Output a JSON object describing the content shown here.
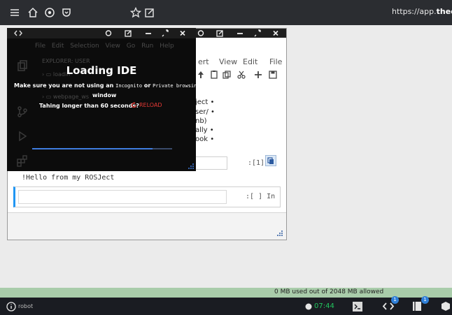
{
  "browser": {
    "url_prefix": "https://app.",
    "url_bold": "theconstr"
  },
  "ide": {
    "menu": "File Edit Selection View Go Run Help",
    "explorer_label": "EXPLORER: USER",
    "tree_item_1": "loadin",
    "tree_item_2": "webpage_ws",
    "title": "Loading IDE",
    "warning_prefix": "Make sure you are not using an",
    "warning_incognito": "Incognito",
    "warning_or": "or",
    "warning_private": "Private browsing",
    "warning_suffix": "window",
    "taking_longer": "Tahing longer than 60 seconds?",
    "reload_label": "RELOAD",
    "progress": 0.86
  },
  "notebook": {
    "menu": [
      "ert",
      "View",
      "Edit",
      "File"
    ],
    "content_lines": [
      "ject •",
      "ser/ •",
      "nb)",
      "ally •",
      "ook •"
    ],
    "cell1_prompt": ":[1]",
    "output_text": "!Hello from my ROSJect",
    "cell2_prompt": ":[ ] In"
  },
  "status": {
    "memory": "0 MB used out of 2048 MB allowed",
    "timer": "07:44"
  },
  "bottom": {
    "robot_label": "robot",
    "badge_1": "1",
    "badge_2": "1"
  },
  "colors": {
    "accent_blue": "#2196f3",
    "reload_red": "#e53935",
    "status_green": "#a9ccaa",
    "timer_green": "#22c55e"
  }
}
